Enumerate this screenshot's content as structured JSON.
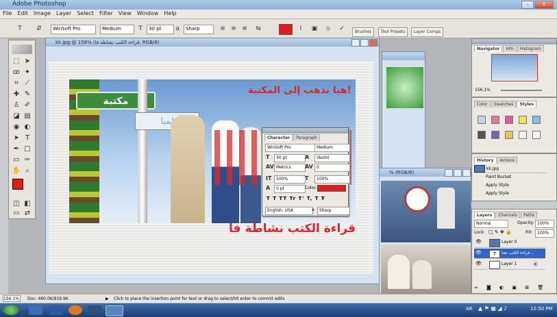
{
  "app": {
    "title": "Adobe Photoshop"
  },
  "menu": [
    "File",
    "Edit",
    "Image",
    "Layer",
    "Select",
    "Filter",
    "View",
    "Window",
    "Help"
  ],
  "options": {
    "font_family": "WinSoft Pro",
    "font_style": "Medium",
    "font_size": "30 pt",
    "aa_label": "a",
    "antialias": "Sharp",
    "palette_tabs": [
      "Brushes",
      "Tool Presets",
      "Layer Comps"
    ]
  },
  "doc_main": {
    "title": "kk.jpg @ 156% (قراءة الكتب نشاطة فا, RGB/8)",
    "banner_left": "مكتبة",
    "banner_right": "هيا نذهب إلى المكتبة!",
    "sign_text": "لميا",
    "caption": "قراءة الكتب نشاطة فا"
  },
  "doc_right_title": "% (RGB/8)",
  "character": {
    "tabs": [
      "Character",
      "Paragraph"
    ],
    "font_family": "WinSoft Pro",
    "font_style": "Medium",
    "size": "30 pt",
    "leading": "(Auto)",
    "kerning": "Metrics",
    "tracking": "0",
    "v_scale": "100%",
    "h_scale": "100%",
    "baseline": "0 pt",
    "color_label": "Color:",
    "style_buttons": "T T TT Tr T' T, T Ŧ",
    "language": "English: USA",
    "antialias": "Sharp",
    "text_color": "#e31b1b"
  },
  "navigator": {
    "tabs": [
      "Navigator",
      "Info",
      "Histogram"
    ],
    "zoom": "156.1%"
  },
  "color_panel": {
    "tabs": [
      "Color",
      "Swatches",
      "Styles"
    ]
  },
  "history": {
    "tabs": [
      "History",
      "Actions"
    ],
    "snapshot": "kk.jpg",
    "items": [
      "Paint Bucket",
      "Apply Style",
      "Apply Style"
    ]
  },
  "layers": {
    "tabs": [
      "Layers",
      "Channels",
      "Paths"
    ],
    "blend": "Normal",
    "opacity_label": "Opacity:",
    "opacity": "100%",
    "lock_label": "Lock:",
    "fill_label": "Fill:",
    "fill": "100%",
    "items": [
      {
        "name": "Layer 0",
        "thumb": ""
      },
      {
        "name": "قراءة الكتب نشا...",
        "thumb": "T"
      },
      {
        "name": "Layer 1",
        "thumb": ""
      }
    ]
  },
  "status": {
    "zoom": "156.1%",
    "doc": "Doc: 460.0K/919.9K",
    "hint": "Click to place the insertion point for text or drag to select/hit enter to commit edits"
  },
  "taskbar": {
    "lang": "AR",
    "time": "12:50 PM"
  }
}
